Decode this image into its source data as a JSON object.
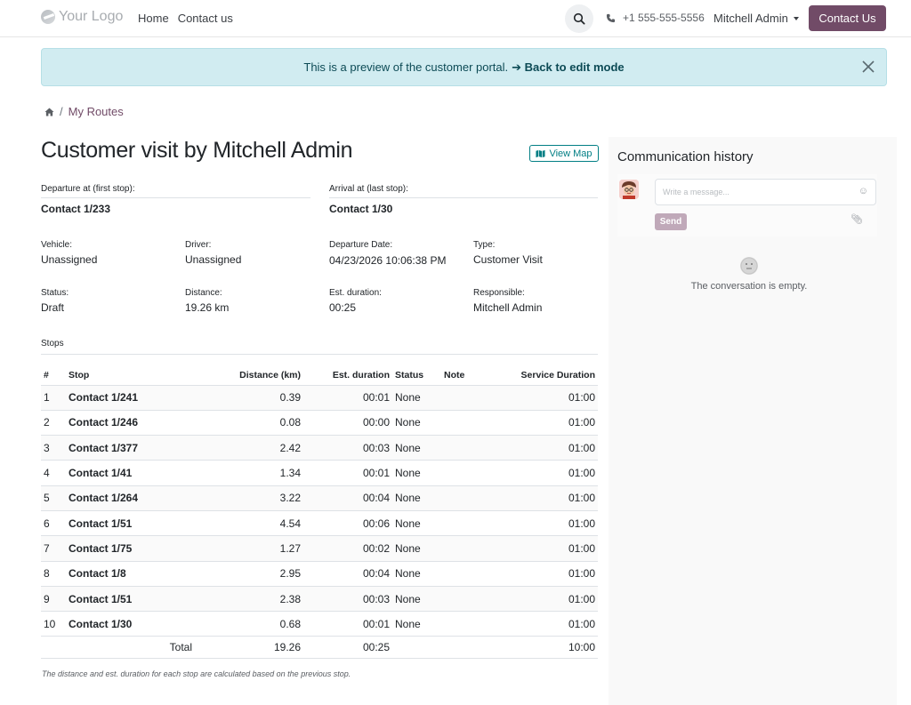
{
  "header": {
    "logo_text": "Your Logo",
    "nav": [
      "Home",
      "Contact us"
    ],
    "phone": "+1 555-555-5556",
    "user": "Mitchell Admin",
    "cta": "Contact Us"
  },
  "alert": {
    "text": "This is a preview of the customer portal.",
    "link": "➔ Back to edit mode"
  },
  "breadcrumb": {
    "current": "My Routes",
    "separator": "/"
  },
  "route": {
    "title": "Customer visit by Mitchell Admin",
    "view_map_label": "View Map",
    "departure_label": "Departure at (first stop):",
    "departure_value": "Contact 1/233",
    "arrival_label": "Arrival at (last stop):",
    "arrival_value": "Contact 1/30",
    "vehicle_label": "Vehicle:",
    "vehicle_value": "Unassigned",
    "driver_label": "Driver:",
    "driver_value": "Unassigned",
    "departure_date_label": "Departure Date:",
    "departure_date_value": "04/23/2026 10:06:38 PM",
    "type_label": "Type:",
    "type_value": "Customer Visit",
    "status_label": "Status:",
    "status_value": "Draft",
    "distance_label": "Distance:",
    "distance_value": "19.26 km",
    "est_duration_label": "Est. duration:",
    "est_duration_value": "00:25",
    "responsible_label": "Responsible:",
    "responsible_value": "Mitchell Admin",
    "stops_label": "Stops"
  },
  "table": {
    "headers": [
      "#",
      "Stop",
      "Distance (km)",
      "Est. duration",
      "Status",
      "Note",
      "Service Duration"
    ],
    "rows": [
      {
        "n": "1",
        "stop": "Contact 1/241",
        "dist": "0.39",
        "dur": "00:01",
        "status": "None",
        "note": "",
        "service": "01:00"
      },
      {
        "n": "2",
        "stop": "Contact 1/246",
        "dist": "0.08",
        "dur": "00:00",
        "status": "None",
        "note": "",
        "service": "01:00"
      },
      {
        "n": "3",
        "stop": "Contact 1/377",
        "dist": "2.42",
        "dur": "00:03",
        "status": "None",
        "note": "",
        "service": "01:00"
      },
      {
        "n": "4",
        "stop": "Contact 1/41",
        "dist": "1.34",
        "dur": "00:01",
        "status": "None",
        "note": "",
        "service": "01:00"
      },
      {
        "n": "5",
        "stop": "Contact 1/264",
        "dist": "3.22",
        "dur": "00:04",
        "status": "None",
        "note": "",
        "service": "01:00"
      },
      {
        "n": "6",
        "stop": "Contact 1/51",
        "dist": "4.54",
        "dur": "00:06",
        "status": "None",
        "note": "",
        "service": "01:00"
      },
      {
        "n": "7",
        "stop": "Contact 1/75",
        "dist": "1.27",
        "dur": "00:02",
        "status": "None",
        "note": "",
        "service": "01:00"
      },
      {
        "n": "8",
        "stop": "Contact 1/8",
        "dist": "2.95",
        "dur": "00:04",
        "status": "None",
        "note": "",
        "service": "01:00"
      },
      {
        "n": "9",
        "stop": "Contact 1/51",
        "dist": "2.38",
        "dur": "00:03",
        "status": "None",
        "note": "",
        "service": "01:00"
      },
      {
        "n": "10",
        "stop": "Contact 1/30",
        "dist": "0.68",
        "dur": "00:01",
        "status": "None",
        "note": "",
        "service": "01:00"
      }
    ],
    "total": {
      "label": "Total",
      "dist": "19.26",
      "dur": "00:25",
      "service": "10:00"
    },
    "footnote": "The distance and est. duration for each stop are calculated based on the previous stop."
  },
  "chatter": {
    "title": "Communication history",
    "placeholder": "Write a message...",
    "send": "Send",
    "empty": "The conversation is empty."
  },
  "colors": {
    "brand": "#714b67",
    "alert_bg": "#d1ecf1",
    "map_btn": "#017e84"
  }
}
